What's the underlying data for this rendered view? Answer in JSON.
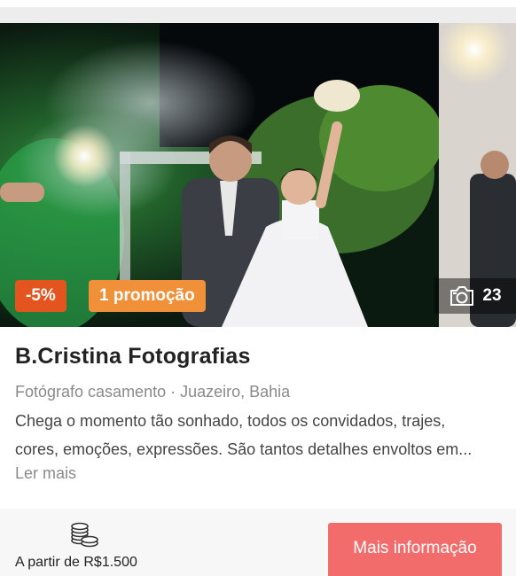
{
  "listing": {
    "discount_badge": "-5%",
    "promo_badge": "1 promoção",
    "photo_count": "23",
    "title": "B.Cristina Fotografias",
    "category": "Fotógrafo casamento · Juazeiro, Bahia",
    "description_line1": "Chega o momento tão sonhado, todos os convidados, trajes,",
    "description_line2": "cores, emoções, expressões. São tantos detalhes envoltos em...",
    "read_more": "Ler mais",
    "price_label": "A partir de R$1.500",
    "cta_label": "Mais informação"
  },
  "colors": {
    "discount": "#e3541e",
    "promo": "#f0913a",
    "cta": "#f26c6c"
  },
  "icons": {
    "photo_count": "camera-icon",
    "price": "coins-icon"
  }
}
